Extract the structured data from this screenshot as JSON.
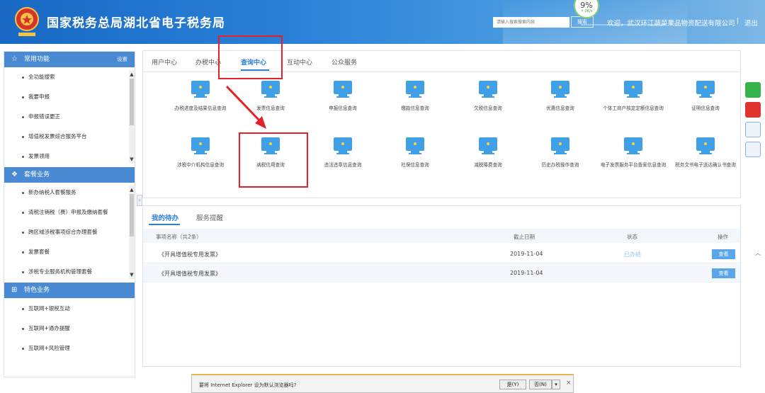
{
  "header": {
    "title": "国家税务总局湖北省电子税务局",
    "search_placeholder": "请输入搜索搜索内容",
    "search_button": "搜索",
    "welcome": "欢迎，武汉环江蔬菜果品物资配送有限公司",
    "separator": "|",
    "logout": "退出",
    "speed_pct": "9%",
    "speed_rate": "↑ 0K/s"
  },
  "sidebar": {
    "section1": {
      "icon": "star-icon",
      "title": "常用功能",
      "action": "设置",
      "items": [
        "全功能搜索",
        "我要申报",
        "申报错误更正",
        "增值税发票综合服务平台",
        "发票领用"
      ]
    },
    "section2": {
      "icon": "layers-icon",
      "title": "套餐业务",
      "items": [
        "新办纳税人套餐服务",
        "清税注销税（费）申报及缴纳套餐",
        "跨区域涉税事项综合办理套餐",
        "发票套餐",
        "涉税专业服务机构管理套餐"
      ]
    },
    "section3": {
      "icon": "grid-icon",
      "title": "特色业务",
      "items": [
        "互联网+银税互动",
        "互联网+通办提醒",
        "互联网+风险管理"
      ]
    }
  },
  "tabs": [
    "用户中心",
    "办税中心",
    "查询中心",
    "互动中心",
    "公众服务"
  ],
  "active_tab": "查询中心",
  "services_row1": [
    "办税进度及结果信息查询",
    "发票信息查询",
    "申报信息查询",
    "缴款信息查询",
    "欠税信息查询",
    "优惠信息查询",
    "个体工商户核定定额信息查询",
    "证明信息查询"
  ],
  "services_row2": [
    "涉税中介机构信息查询",
    "纳税信用查询",
    "违法违章信息查询",
    "社保信息查询",
    "减税降费查询",
    "历史办税操作查询",
    "电子发票服务平台备案信息查询",
    "税务文书电子送达确认书查询"
  ],
  "todo": {
    "tab_active": "我的待办",
    "tab_other": "服务提醒",
    "columns": [
      "事项名称（共2条）",
      "截止日期",
      "状态",
      "操作"
    ],
    "rows": [
      {
        "name": "《开具增值税专用发票》",
        "date": "2019-11-04",
        "status": "已办结",
        "action": "查看"
      },
      {
        "name": "《开具增值税专用发票》",
        "date": "2019-11-04",
        "status": "",
        "action": "查看"
      }
    ]
  },
  "ie_bar": {
    "message": "要将 Internet Explorer 设为默认浏览器吗?",
    "yes": "是(Y)",
    "no": "否(N)",
    "dropdown": "▾",
    "close": "×"
  },
  "colors": {
    "header_blue": "#1868c4",
    "accent": "#2f7fd6",
    "highlight_red": "#e4202a",
    "button_blue": "#5aa6ea"
  }
}
